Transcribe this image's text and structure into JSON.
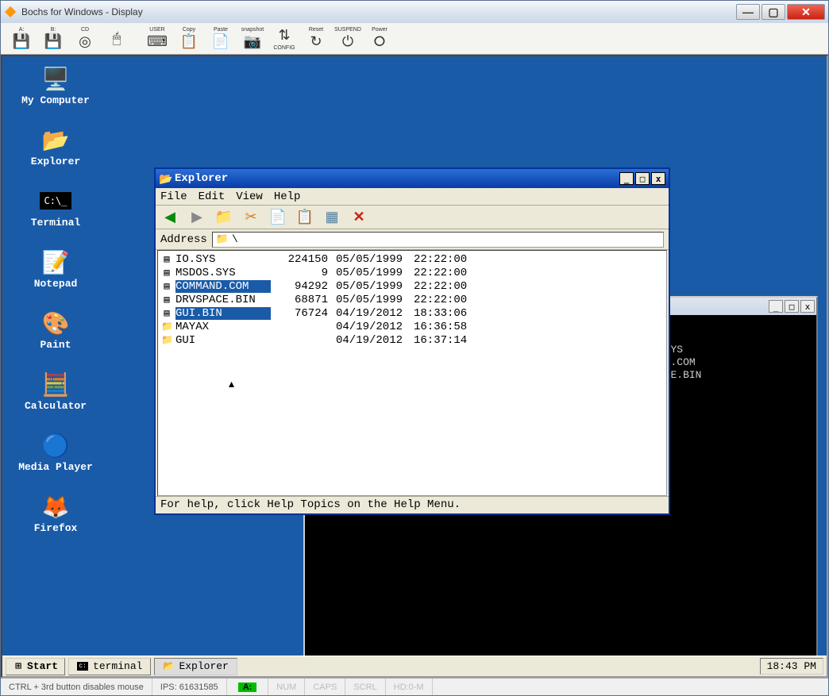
{
  "outer": {
    "title": "Bochs for Windows - Display",
    "toolbar_labels": {
      "a": "A:",
      "b": "B:",
      "cd": "CD",
      "mouse": "",
      "user": "USER",
      "copy": "Copy",
      "paste": "Paste",
      "snapshot": "snapshot",
      "config": "CONFIG",
      "reset": "Reset",
      "suspend": "SUSPEND",
      "power": "Power"
    }
  },
  "desktop_icons": [
    "My Computer",
    "Explorer",
    "Terminal",
    "Notepad",
    "Paint",
    "Calculator",
    "Media Player",
    "Firefox"
  ],
  "explorer": {
    "title": "Explorer",
    "menu": [
      "File",
      "Edit",
      "View",
      "Help"
    ],
    "address_label": "Address",
    "address_value": "\\",
    "status": "For help, click Help Topics on the Help Menu.",
    "files": [
      {
        "icon": "file",
        "name": "IO.SYS",
        "size": "224150",
        "date": "05/05/1999",
        "time": "22:22:00",
        "sel": false
      },
      {
        "icon": "file",
        "name": "MSDOS.SYS",
        "size": "9",
        "date": "05/05/1999",
        "time": "22:22:00",
        "sel": false
      },
      {
        "icon": "file",
        "name": "COMMAND.COM",
        "size": "94292",
        "date": "05/05/1999",
        "time": "22:22:00",
        "sel": true
      },
      {
        "icon": "file",
        "name": "DRVSPACE.BIN",
        "size": "68871",
        "date": "05/05/1999",
        "time": "22:22:00",
        "sel": false
      },
      {
        "icon": "file",
        "name": "GUI.BIN",
        "size": "76724",
        "date": "04/19/2012",
        "time": "18:33:06",
        "sel": true
      },
      {
        "icon": "folder",
        "name": "MAYAX",
        "size": "",
        "date": "04/19/2012",
        "time": "16:36:58",
        "sel": false
      },
      {
        "icon": "folder",
        "name": "GUI",
        "size": "",
        "date": "04/19/2012",
        "time": "16:37:14",
        "sel": false
      }
    ]
  },
  "terminal_text": "#ls \\\nIO       SYS  05/05/1999 22:~2:00           224150 IO.SYS\nMSDOS    SYS  05/05/1999 22:22:00                9 MSDOS.SYS\nCOMMAND  COM  05/05/1999 22:22:00            94292 COMMAND.COM\nDRVSPACE BIN  05/05/1999 22:22:00            68871 DRVSPACE.BIN\nGUI      BIN  04/19/2012 18:33:06            76724 GUI.BIN\nMAYAX         04/19/2012 16:36:58 <DIR>          0 MAYAX\nGUI           04/19/2012 16:37:14 <DIR>          0 GUI\n#_",
  "taskbar": {
    "start": "Start",
    "terminal": "terminal",
    "explorer": "Explorer",
    "clock": "18:43 PM"
  },
  "status": {
    "mouse": "CTRL + 3rd button disables mouse",
    "ips": "IPS: 61631585",
    "drive": "A:",
    "num": "NUM",
    "caps": "CAPS",
    "scrl": "SCRL",
    "hd": "HD:0-M"
  }
}
